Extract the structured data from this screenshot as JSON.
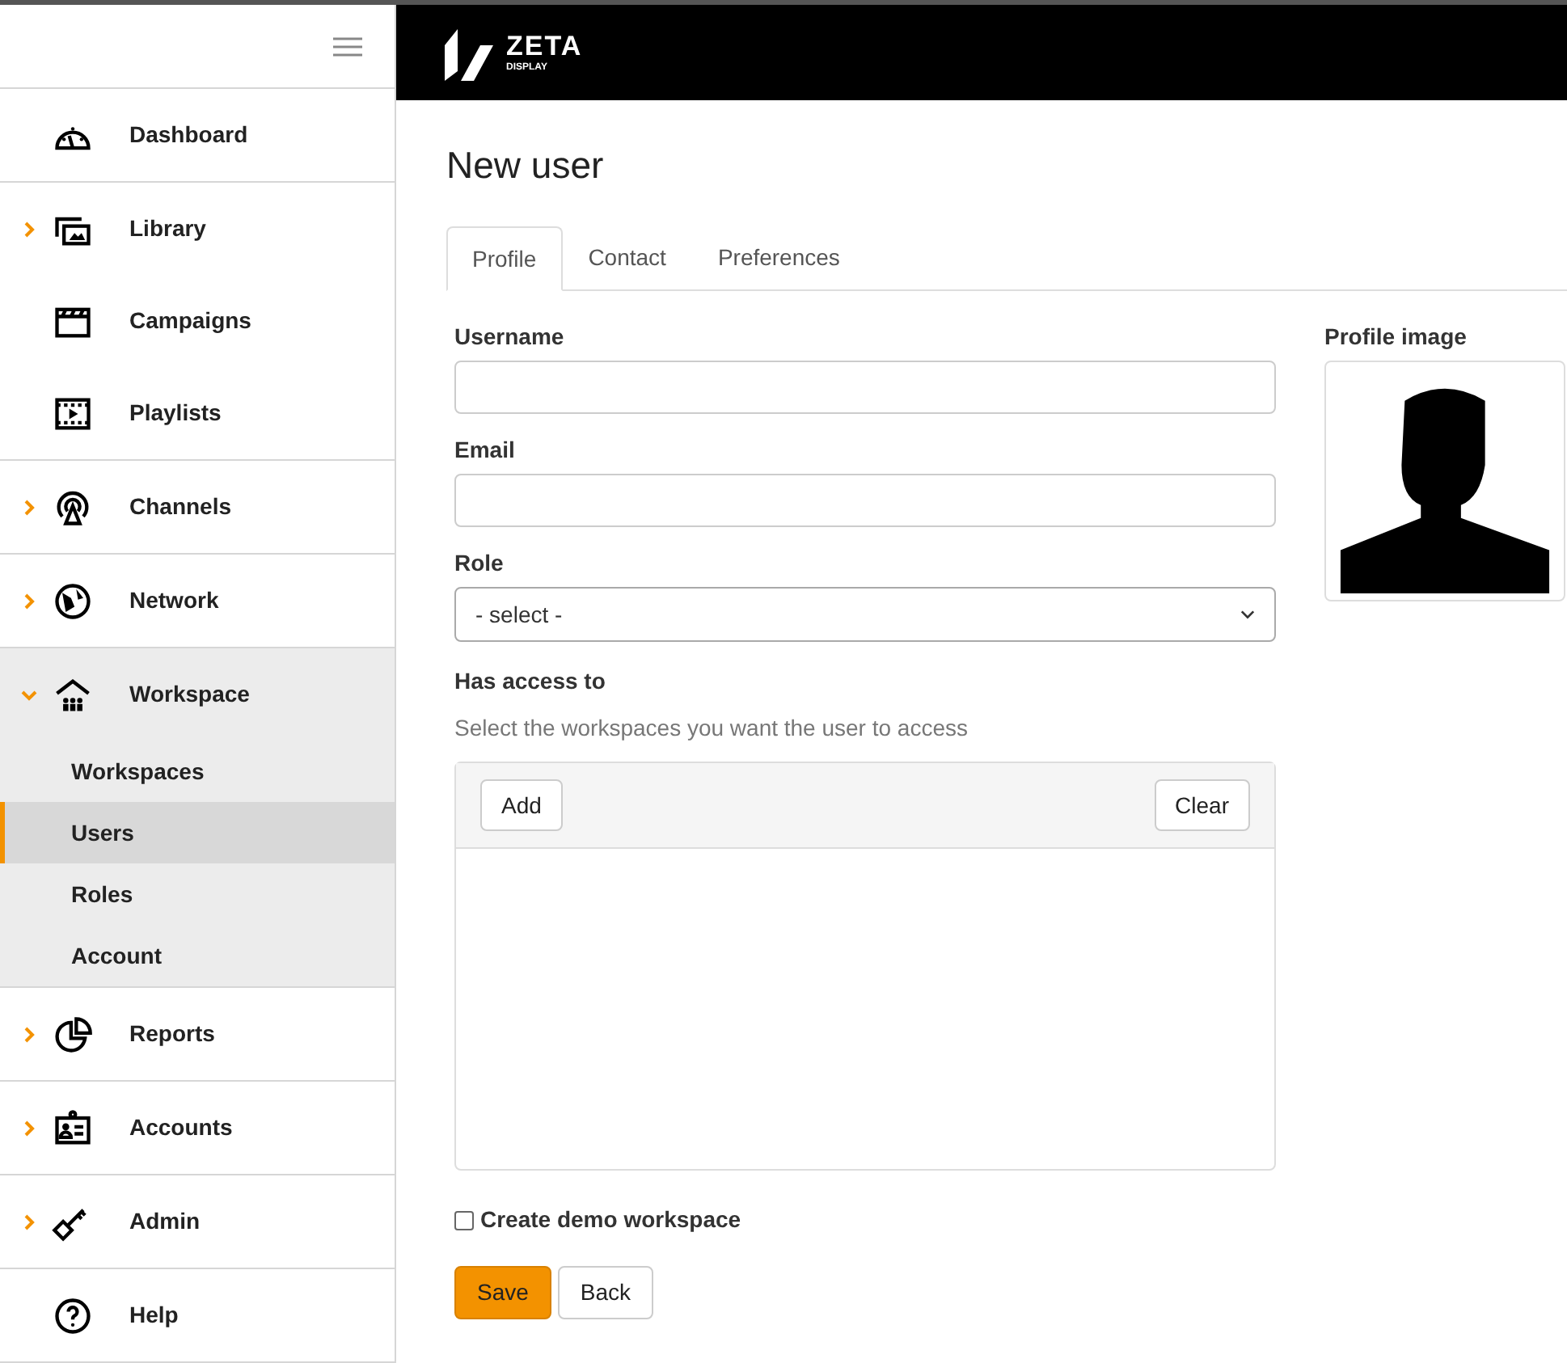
{
  "logo": {
    "word": "ZETA",
    "sub": "DISPLAY"
  },
  "sidebar": {
    "groups": [
      [
        {
          "label": "Dashboard",
          "kind": "link"
        }
      ],
      [
        {
          "label": "Library",
          "kind": "expandable",
          "expanded": false
        },
        {
          "label": "Campaigns",
          "kind": "link"
        },
        {
          "label": "Playlists",
          "kind": "link"
        }
      ],
      [
        {
          "label": "Channels",
          "kind": "expandable",
          "expanded": false
        }
      ],
      [
        {
          "label": "Network",
          "kind": "expandable",
          "expanded": false
        }
      ],
      [
        {
          "label": "Workspace",
          "kind": "expandable",
          "expanded": true,
          "children": [
            {
              "label": "Workspaces",
              "selected": false
            },
            {
              "label": "Users",
              "selected": true
            },
            {
              "label": "Roles",
              "selected": false
            },
            {
              "label": "Account",
              "selected": false
            }
          ]
        }
      ],
      [
        {
          "label": "Reports",
          "kind": "expandable",
          "expanded": false
        }
      ],
      [
        {
          "label": "Accounts",
          "kind": "expandable",
          "expanded": false
        }
      ],
      [
        {
          "label": "Admin",
          "kind": "expandable",
          "expanded": false
        }
      ],
      [
        {
          "label": "Help",
          "kind": "link"
        }
      ]
    ]
  },
  "page": {
    "title": "New user"
  },
  "tabs": [
    {
      "label": "Profile",
      "selected": true
    },
    {
      "label": "Contact",
      "selected": false
    },
    {
      "label": "Preferences",
      "selected": false
    }
  ],
  "form": {
    "username": {
      "label": "Username"
    },
    "email": {
      "label": "Email"
    },
    "role": {
      "label": "Role",
      "value": "- select -"
    },
    "access": {
      "label": "Has access to",
      "hint": "Select the workspaces you want the user to access",
      "add": "Add",
      "clear": "Clear"
    },
    "demo": {
      "label": "Create demo workspace",
      "checked": false
    },
    "buttons": {
      "save": "Save",
      "back": "Back"
    }
  },
  "profile_image": {
    "label": "Profile image"
  }
}
